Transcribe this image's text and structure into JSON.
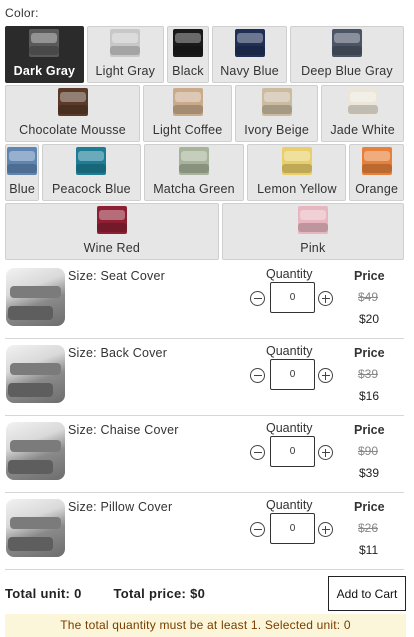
{
  "color_label": "Color:",
  "selected_color": "Dark Gray",
  "colors": [
    {
      "label": "Dark Gray",
      "swatch": "#5a5a5a",
      "selected": true
    },
    {
      "label": "Light Gray",
      "swatch": "#c8c8c8",
      "selected": false
    },
    {
      "label": "Black",
      "swatch": "#1a1a1a",
      "selected": false
    },
    {
      "label": "Navy Blue",
      "swatch": "#1f2f55",
      "selected": false
    },
    {
      "label": "Deep Blue Gray",
      "swatch": "#4b5566",
      "selected": false
    },
    {
      "label": "Chocolate Mousse",
      "swatch": "#5a3a28",
      "selected": false
    },
    {
      "label": "Light Coffee",
      "swatch": "#c9ab8c",
      "selected": false
    },
    {
      "label": "Ivory Beige",
      "swatch": "#cbbba0",
      "selected": false
    },
    {
      "label": "Jade White",
      "swatch": "#ece6da",
      "selected": false
    },
    {
      "label": "Blue",
      "swatch": "#5f86b3",
      "selected": false
    },
    {
      "label": "Peacock Blue",
      "swatch": "#1d7d95",
      "selected": false
    },
    {
      "label": "Matcha Green",
      "swatch": "#a7b39a",
      "selected": false
    },
    {
      "label": "Lemon Yellow",
      "swatch": "#e9cf6b",
      "selected": false
    },
    {
      "label": "Orange",
      "swatch": "#e6803a",
      "selected": false
    },
    {
      "label": "Wine Red",
      "swatch": "#8e1f33",
      "selected": false
    },
    {
      "label": "Pink",
      "swatch": "#e8b6bf",
      "selected": false
    }
  ],
  "products": [
    {
      "size": "Size: Seat Cover",
      "quantity_label": "Quantity",
      "quantity": "0",
      "price_label": "Price",
      "old_price": "$49",
      "new_price": "$20"
    },
    {
      "size": "Size: Back Cover",
      "quantity_label": "Quantity",
      "quantity": "0",
      "price_label": "Price",
      "old_price": "$39",
      "new_price": "$16"
    },
    {
      "size": "Size: Chaise Cover",
      "quantity_label": "Quantity",
      "quantity": "0",
      "price_label": "Price",
      "old_price": "$90",
      "new_price": "$39"
    },
    {
      "size": "Size: Pillow Cover",
      "quantity_label": "Quantity",
      "quantity": "0",
      "price_label": "Price",
      "old_price": "$26",
      "new_price": "$11"
    }
  ],
  "totals": {
    "unit_label": "Total unit:",
    "unit_value": "0",
    "price_label": "Total price:",
    "price_value": "$0"
  },
  "add_to_cart_label": "Add to Cart",
  "warning": "The total quantity must be at least 1. Selected unit: 0",
  "colors_theme": {
    "selected_bg": "#2b2b2b",
    "swatch_bg": "#e6e6e6",
    "warning_bg": "#fbf6d9",
    "warning_text": "#7a3b00"
  }
}
